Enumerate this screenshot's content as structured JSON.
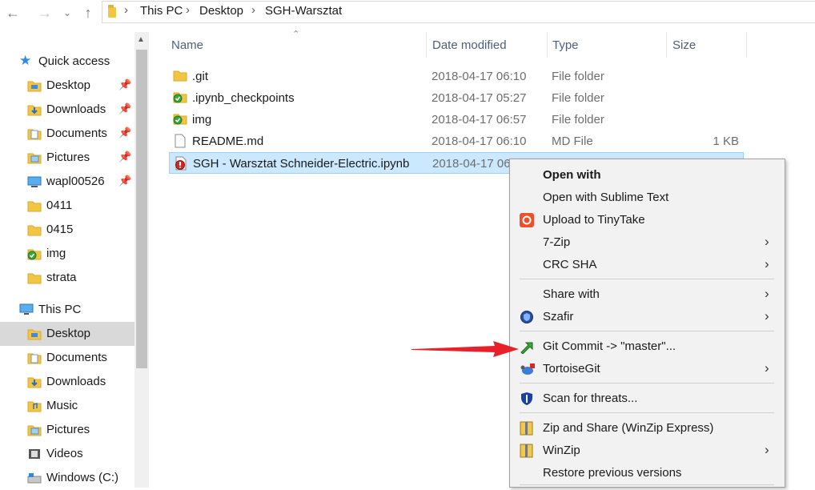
{
  "breadcrumb": [
    "This PC",
    "Desktop",
    "SGH-Warsztat"
  ],
  "nav": {
    "quick_access": "Quick access",
    "quick_items": [
      {
        "label": "Desktop",
        "icon": "desktop-folder-icon",
        "pinned": true
      },
      {
        "label": "Downloads",
        "icon": "downloads-folder-icon",
        "pinned": true
      },
      {
        "label": "Documents",
        "icon": "documents-folder-icon",
        "pinned": true
      },
      {
        "label": "Pictures",
        "icon": "pictures-folder-icon",
        "pinned": true
      },
      {
        "label": "wapl00526",
        "icon": "computer-icon",
        "pinned": true
      },
      {
        "label": "0411",
        "icon": "folder-icon",
        "pinned": false
      },
      {
        "label": "0415",
        "icon": "folder-icon",
        "pinned": false
      },
      {
        "label": "img",
        "icon": "git-folder-icon",
        "pinned": false
      },
      {
        "label": "strata",
        "icon": "folder-icon",
        "pinned": false
      }
    ],
    "this_pc": "This PC",
    "pc_items": [
      {
        "label": "Desktop",
        "icon": "desktop-folder-icon"
      },
      {
        "label": "Documents",
        "icon": "documents-folder-icon"
      },
      {
        "label": "Downloads",
        "icon": "downloads-folder-icon"
      },
      {
        "label": "Music",
        "icon": "music-folder-icon"
      },
      {
        "label": "Pictures",
        "icon": "pictures-folder-icon"
      },
      {
        "label": "Videos",
        "icon": "videos-folder-icon"
      },
      {
        "label": "Windows (C:)",
        "icon": "drive-icon"
      }
    ]
  },
  "columns": {
    "name": "Name",
    "date": "Date modified",
    "type": "Type",
    "size": "Size"
  },
  "files": [
    {
      "name": ".git",
      "date": "2018-04-17 06:10",
      "type": "File folder",
      "size": "",
      "icon": "folder-icon"
    },
    {
      "name": ".ipynb_checkpoints",
      "date": "2018-04-17 05:27",
      "type": "File folder",
      "size": "",
      "icon": "git-folder-icon"
    },
    {
      "name": "img",
      "date": "2018-04-17 06:57",
      "type": "File folder",
      "size": "",
      "icon": "git-folder-icon"
    },
    {
      "name": "README.md",
      "date": "2018-04-17 06:10",
      "type": "MD File",
      "size": "1 KB",
      "icon": "file-icon"
    },
    {
      "name": "SGH - Warsztat Schneider-Electric.ipynb",
      "date": "2018-04-17 06",
      "type": "",
      "size": "",
      "icon": "git-modified-file-icon"
    }
  ],
  "menu": {
    "items": [
      {
        "label": "Open with",
        "bold": true,
        "arrow": false
      },
      {
        "label": "Open with Sublime Text",
        "arrow": false
      },
      {
        "label": "Upload to TinyTake",
        "arrow": false
      },
      {
        "label": "7-Zip",
        "arrow": true
      },
      {
        "label": "CRC SHA",
        "arrow": true
      },
      {
        "label": "Share with",
        "arrow": true
      },
      {
        "label": "Szafir",
        "arrow": true
      },
      {
        "label": "Git Commit -> \"master\"...",
        "arrow": false
      },
      {
        "label": "TortoiseGit",
        "arrow": true
      },
      {
        "label": "Scan for threats...",
        "arrow": false
      },
      {
        "label": "Zip and Share (WinZip Express)",
        "arrow": false
      },
      {
        "label": "WinZip",
        "arrow": true
      },
      {
        "label": "Restore previous versions",
        "arrow": false
      }
    ]
  },
  "colors": {
    "selection": "#cce8ff",
    "arrow": "#e8202a"
  }
}
